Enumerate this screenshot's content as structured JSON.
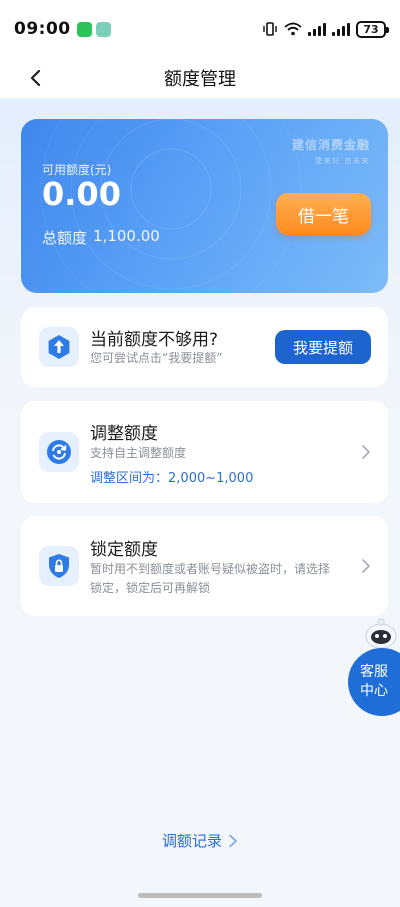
{
  "status_bar": {
    "time": "09:00",
    "battery": "73",
    "app_icons": [
      "wechat-icon",
      "app-icon"
    ],
    "colors": {
      "wechat": "#2cc45a",
      "app": "#7ad0b8"
    }
  },
  "nav": {
    "title": "额度管理",
    "back_icon": "chevron-left-icon"
  },
  "credit_card": {
    "brand_name": "建信消费金融",
    "brand_slogan": "建美好  信未来",
    "available_label": "可用额度(元)",
    "available_amount": "0.00",
    "total_label": "总额度",
    "total_amount": "1,100.00",
    "borrow_button": "借一笔"
  },
  "raise_panel": {
    "icon": "arrow-up-hex-icon",
    "title": "当前额度不够用?",
    "subtitle": "您可尝试点击“我要提额”",
    "button": "我要提额"
  },
  "adjust_panel": {
    "icon": "adjust-cycle-icon",
    "title": "调整额度",
    "subtitle": "支持自主调整额度",
    "range_label": "调整区间为：",
    "range_value": "2,000~1,000"
  },
  "lock_panel": {
    "icon": "lock-shield-icon",
    "title": "锁定额度",
    "line1": "暂时用不到额度或者账号疑似被盗时，请选择",
    "line2": "锁定，锁定后可再解锁"
  },
  "customer_service": {
    "line1": "客服",
    "line2": "中心"
  },
  "history": {
    "label": "调额记录"
  },
  "theme": {
    "accent": "#1e64cf",
    "orange": "#ff8a1f",
    "link": "#2a6fd6"
  }
}
